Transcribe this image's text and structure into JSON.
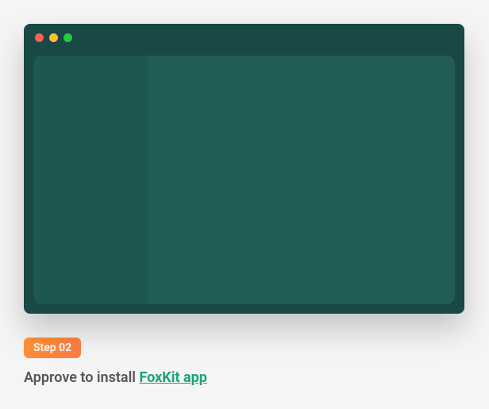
{
  "window": {
    "controls": {
      "close": "close",
      "minimize": "minimize",
      "maximize": "maximize"
    }
  },
  "step": {
    "badge": "Step 02",
    "description_prefix": "Approve to install ",
    "app_link_text": "FoxKit app"
  }
}
